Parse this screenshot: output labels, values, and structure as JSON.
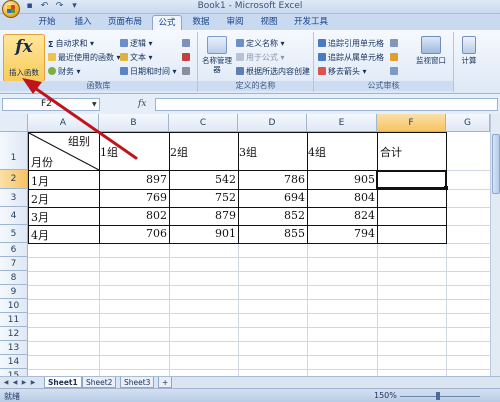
{
  "window": {
    "title": "Book1 - Microsoft Excel"
  },
  "quick_access": [
    {
      "icon": "save-icon",
      "glyph": "▪"
    },
    {
      "icon": "undo-icon",
      "glyph": "↶"
    },
    {
      "icon": "redo-icon",
      "glyph": "↷"
    },
    {
      "icon": "customize-icon",
      "glyph": "▾"
    }
  ],
  "tabs": [
    "开始",
    "插入",
    "页面布局",
    "公式",
    "数据",
    "审阅",
    "视图",
    "开发工具"
  ],
  "active_tab": "公式",
  "ribbon": {
    "insert_function": {
      "glyph": "fx",
      "label": "插入函数"
    },
    "library": {
      "label": "函数库",
      "autosum": "自动求和",
      "recent": "最近使用的函数",
      "financial": "财务",
      "logical": "逻辑",
      "text": "文本",
      "datetime": "日期和时间"
    },
    "names": {
      "label": "定义的名称",
      "name_manager": "名称管理器",
      "define_name": "定义名称",
      "use_in_formula": "用于公式",
      "create_from_selection": "根据所选内容创建"
    },
    "audit": {
      "label": "公式审核",
      "trace_precedents": "追踪引用单元格",
      "trace_dependents": "追踪从属单元格",
      "remove_arrows": "移去箭头",
      "watch_window": "监视窗口"
    },
    "calc": {
      "label": "计算"
    }
  },
  "formula_bar": {
    "name_box": "F2",
    "fx": "fx",
    "formula": ""
  },
  "columns": [
    "A",
    "B",
    "C",
    "D",
    "E",
    "F",
    "G"
  ],
  "selected_column": "F",
  "rows": [
    "1",
    "2",
    "3",
    "4",
    "5",
    "6",
    "7",
    "8",
    "9",
    "10",
    "11",
    "12",
    "13",
    "14",
    "15"
  ],
  "selected_row": "2",
  "table": {
    "header_diag_top": "组别",
    "header_diag_bottom": "月份",
    "groups": [
      "1组",
      "2组",
      "3组",
      "4组"
    ],
    "total": "合计",
    "data": [
      {
        "month": "1月",
        "values": [
          897,
          542,
          786,
          905
        ]
      },
      {
        "month": "2月",
        "values": [
          769,
          752,
          694,
          804
        ]
      },
      {
        "month": "3月",
        "values": [
          802,
          879,
          852,
          824
        ]
      },
      {
        "month": "4月",
        "values": [
          706,
          901,
          855,
          794
        ]
      }
    ]
  },
  "sheets": [
    "Sheet1",
    "Sheet2",
    "Sheet3"
  ],
  "active_sheet": "Sheet1",
  "status": {
    "text": "就绪",
    "zoom": "150%"
  },
  "colors": {
    "selection_accent": "#f7c462",
    "annotation_arrow": "#c0141c"
  }
}
